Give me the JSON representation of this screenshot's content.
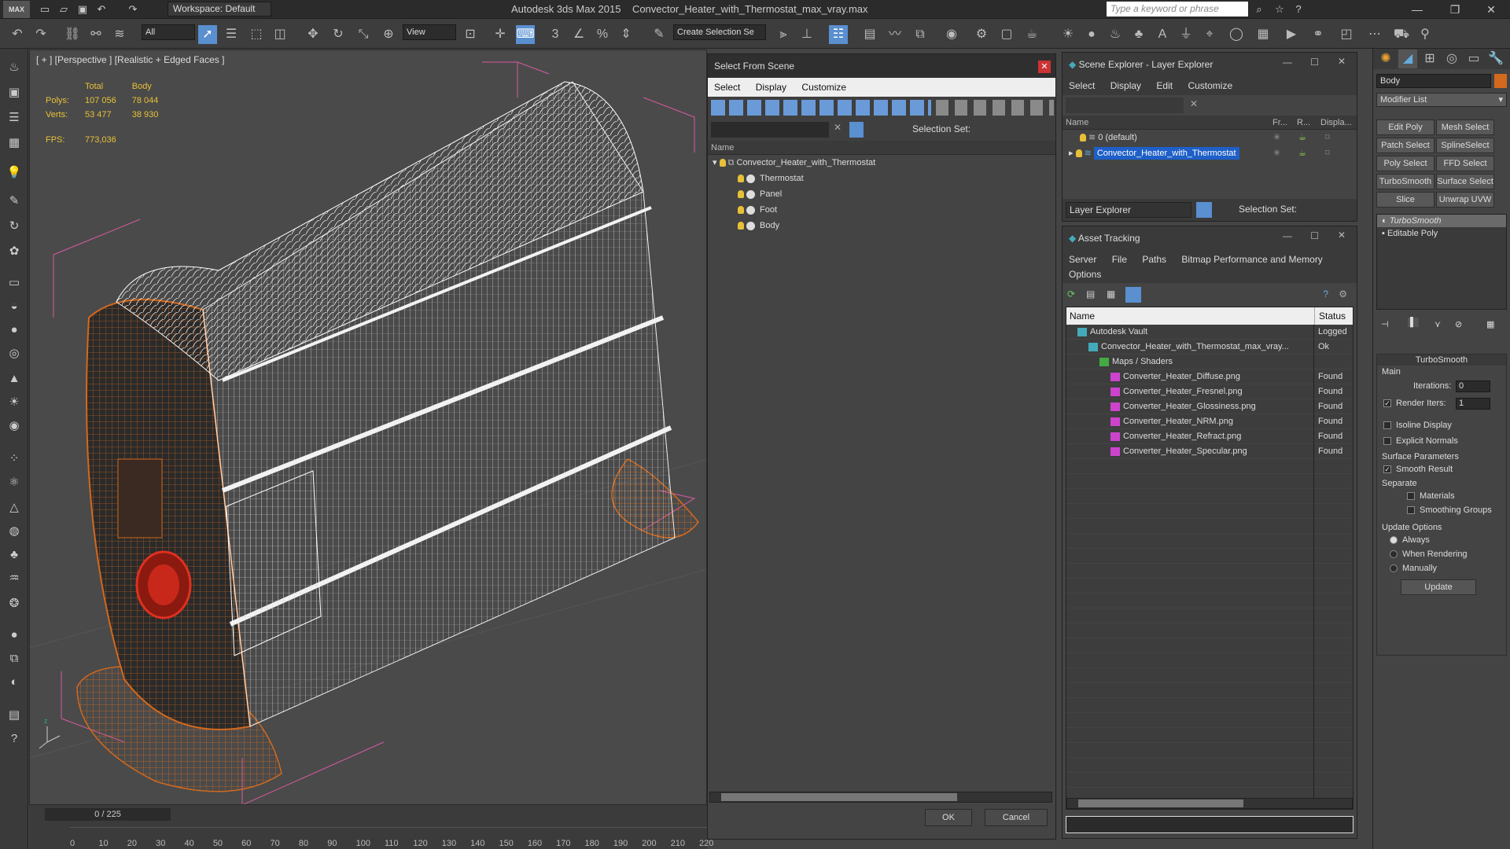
{
  "app": {
    "title": "Autodesk 3ds Max  2015",
    "file": "Convector_Heater_with_Thermostat_max_vray.max",
    "logo": "MAX",
    "workspace": "Workspace: Default",
    "search_placeholder": "Type a keyword or phrase"
  },
  "toolbar": {
    "filter": "All",
    "refcoord": "View",
    "selset": "Create Selection Se"
  },
  "viewport": {
    "label": "[ + ] [Perspective ] [Realistic + Edged Faces ]",
    "stats_header": [
      "",
      "Total",
      "Body"
    ],
    "stats": [
      [
        "Polys:",
        "107 056",
        "78 044"
      ],
      [
        "Verts:",
        "53 477",
        "38 930"
      ]
    ],
    "fps_label": "FPS:",
    "fps_value": "773,036"
  },
  "timeline": {
    "frame": "0 / 225",
    "ticks": [
      "0",
      "10",
      "20",
      "30",
      "40",
      "50",
      "60",
      "70",
      "80",
      "90",
      "100",
      "110",
      "120",
      "130",
      "140",
      "150",
      "160",
      "170",
      "180",
      "190",
      "200",
      "210",
      "220"
    ]
  },
  "select_from_scene": {
    "title": "Select From Scene",
    "menu": [
      "Select",
      "Display",
      "Customize"
    ],
    "selection_set": "Selection Set:",
    "column": "Name",
    "root": "Convector_Heater_with_Thermostat",
    "children": [
      "Thermostat",
      "Panel",
      "Foot",
      "Body"
    ],
    "ok": "OK",
    "cancel": "Cancel"
  },
  "scene_explorer": {
    "title": "Scene Explorer - Layer Explorer",
    "menu": [
      "Select",
      "Display",
      "Edit",
      "Customize"
    ],
    "columns": [
      "Name",
      "Fr...",
      "R...",
      "Displa..."
    ],
    "layers": [
      "0 (default)",
      "Convector_Heater_with_Thermostat"
    ],
    "footer": "Layer Explorer",
    "selection_set": "Selection Set:"
  },
  "asset_tracking": {
    "title": "Asset Tracking",
    "menu": [
      "Server",
      "File",
      "Paths",
      "Bitmap Performance and Memory"
    ],
    "menu2": "Options",
    "columns": [
      "Name",
      "Status"
    ],
    "rows": [
      {
        "name": "Autodesk Vault",
        "status": "Logged",
        "indent": 1
      },
      {
        "name": "Convector_Heater_with_Thermostat_max_vray...",
        "status": "Ok",
        "indent": 2
      },
      {
        "name": "Maps / Shaders",
        "status": "",
        "indent": 3
      },
      {
        "name": "Converter_Heater_Diffuse.png",
        "status": "Found",
        "indent": 4
      },
      {
        "name": "Converter_Heater_Fresnel.png",
        "status": "Found",
        "indent": 4
      },
      {
        "name": "Converter_Heater_Glossiness.png",
        "status": "Found",
        "indent": 4
      },
      {
        "name": "Converter_Heater_NRM.png",
        "status": "Found",
        "indent": 4
      },
      {
        "name": "Converter_Heater_Refract.png",
        "status": "Found",
        "indent": 4
      },
      {
        "name": "Converter_Heater_Specular.png",
        "status": "Found",
        "indent": 4
      }
    ]
  },
  "command_panel": {
    "object_name": "Body",
    "modifier_list": "Modifier List",
    "buttons": [
      "Edit Poly",
      "Mesh Select",
      "Patch Select",
      "SplineSelect",
      "Poly Select",
      "FFD Select",
      "TurboSmooth",
      "Surface Select",
      "Slice",
      "Unwrap UVW"
    ],
    "stack": [
      "TurboSmooth",
      "Editable Poly"
    ],
    "rollout": "TurboSmooth",
    "main": "Main",
    "iterations_label": "Iterations:",
    "iterations": "0",
    "render_iters_label": "Render Iters:",
    "render_iters": "1",
    "isoline": "Isoline Display",
    "explicit": "Explicit Normals",
    "surface_params": "Surface Parameters",
    "smooth_result": "Smooth Result",
    "separate": "Separate",
    "materials": "Materials",
    "smoothing_groups": "Smoothing Groups",
    "update_options": "Update Options",
    "always": "Always",
    "when_rendering": "When Rendering",
    "manually": "Manually",
    "update": "Update"
  },
  "colors": {
    "accent": "#5a8fd0",
    "wire_orange": "#d2691e",
    "selection": "#1e5fc8"
  }
}
